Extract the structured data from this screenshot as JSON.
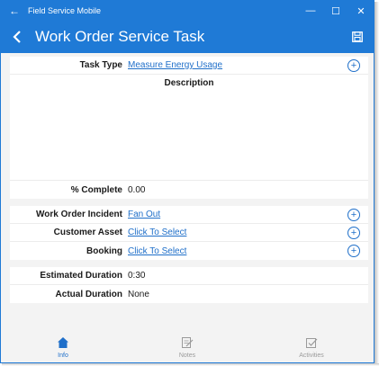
{
  "window": {
    "title": "Field Service Mobile",
    "back_glyph": "←",
    "minimize": "—",
    "maximize": "☐",
    "close": "✕"
  },
  "appbar": {
    "title": "Work Order Service Task",
    "back_icon": "chevron-left-icon",
    "save_icon": "save-icon"
  },
  "colors": {
    "accent": "#1f7ad6",
    "link": "#1f6fc9",
    "background": "#f3f3f3"
  },
  "form": {
    "task_type": {
      "label": "Task Type",
      "value": "Measure Energy Usage"
    },
    "description": {
      "label": "Description"
    },
    "percent_complete": {
      "label": "% Complete",
      "value": "0.00"
    },
    "incident": {
      "label": "Work Order Incident",
      "value": "Fan Out"
    },
    "customer_asset": {
      "label": "Customer Asset",
      "value": "Click To Select"
    },
    "booking": {
      "label": "Booking",
      "value": "Click To Select"
    },
    "estimated_duration": {
      "label": "Estimated Duration",
      "value": "0:30"
    },
    "actual_duration": {
      "label": "Actual Duration",
      "value": "None"
    }
  },
  "nav": {
    "items": [
      {
        "label": "Info",
        "icon": "home-icon",
        "active": true
      },
      {
        "label": "Notes",
        "icon": "notes-icon",
        "active": false
      },
      {
        "label": "Activities",
        "icon": "activities-icon",
        "active": false
      }
    ]
  }
}
